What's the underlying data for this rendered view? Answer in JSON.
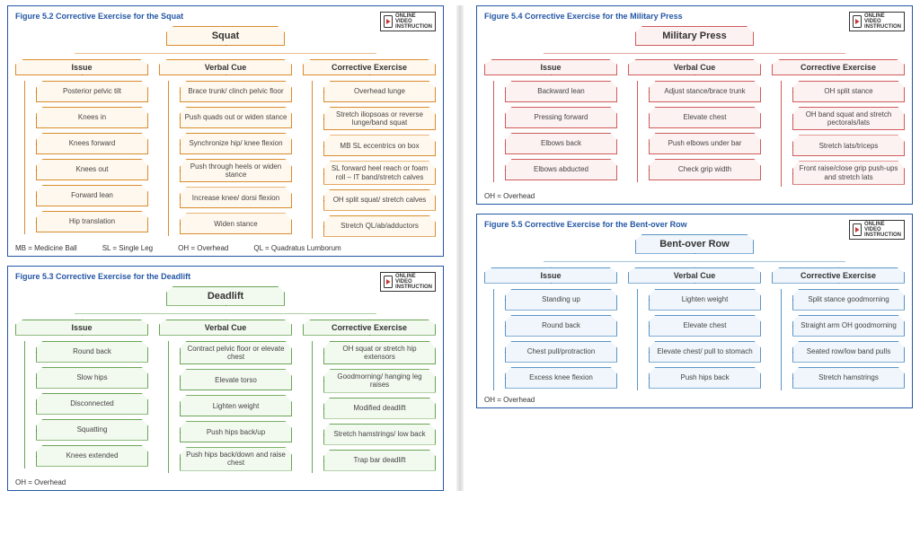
{
  "video_badge": {
    "line1": "ONLINE",
    "line2": "VIDEO",
    "line3": "INSTRUCTION"
  },
  "panels": [
    {
      "id": "squat",
      "title": "Figure 5.2   Corrective Exercise for the Squat",
      "root": "Squat",
      "theme": "theme-orange",
      "columns": [
        {
          "head": "Issue",
          "items": [
            "Posterior pelvic tilt",
            "Knees in",
            "Knees forward",
            "Knees out",
            "Forward lean",
            "Hip translation"
          ]
        },
        {
          "head": "Verbal Cue",
          "items": [
            "Brace trunk/ clinch pelvic floor",
            "Push quads out or widen stance",
            "Synchronize hip/ knee flexion",
            "Push through heels or widen stance",
            "Increase knee/ dorsi flexion",
            "Widen stance"
          ]
        },
        {
          "head": "Corrective Exercise",
          "items": [
            "Overhead lunge",
            "Stretch iliopsoas or reverse lunge/band squat",
            "MB SL eccentrics on box",
            "SL forward heel reach or foam roll – IT band/stretch calves",
            "OH split squat/ stretch calves",
            "Stretch QL/ab/adductors"
          ]
        }
      ],
      "legend": [
        "MB  = Medicine Ball",
        "SL  = Single Leg",
        "OH  = Overhead",
        "QL  = Quadratus Lumborum"
      ]
    },
    {
      "id": "deadlift",
      "title": "Figure 5.3   Corrective Exercise for the Deadlift",
      "root": "Deadlift",
      "theme": "theme-green",
      "columns": [
        {
          "head": "Issue",
          "items": [
            "Round back",
            "Slow hips",
            "Disconnected",
            "Squatting",
            "Knees extended"
          ]
        },
        {
          "head": "Verbal Cue",
          "items": [
            "Contract pelvic floor or elevate chest",
            "Elevate torso",
            "Lighten weight",
            "Push hips back/up",
            "Push hips back/down and raise chest"
          ]
        },
        {
          "head": "Corrective Exercise",
          "items": [
            "OH squat or stretch hip extensors",
            "Goodmorning/ hanging leg raises",
            "Modified deadlift",
            "Stretch hamstrings/ low back",
            "Trap bar deadlift"
          ]
        }
      ],
      "legend": [
        "OH  = Overhead"
      ]
    },
    {
      "id": "military",
      "title": "Figure 5.4   Corrective Exercise for the Military Press",
      "root": "Military Press",
      "theme": "theme-red",
      "columns": [
        {
          "head": "Issue",
          "items": [
            "Backward lean",
            "Pressing forward",
            "Elbows back",
            "Elbows abducted"
          ]
        },
        {
          "head": "Verbal Cue",
          "items": [
            "Adjust stance/brace trunk",
            "Elevate chest",
            "Push elbows under bar",
            "Check grip width"
          ]
        },
        {
          "head": "Corrective Exercise",
          "items": [
            "OH split stance",
            "OH band squat and stretch pectorals/lats",
            "Stretch lats/triceps",
            "Front raise/close grip push-ups and stretch lats"
          ]
        }
      ],
      "legend": [
        "OH  = Overhead"
      ]
    },
    {
      "id": "row",
      "title": "Figure 5.5   Corrective Exercise for the Bent-over Row",
      "root": "Bent-over Row",
      "theme": "theme-blue",
      "columns": [
        {
          "head": "Issue",
          "items": [
            "Standing up",
            "Round back",
            "Chest pull/protraction",
            "Excess knee flexion"
          ]
        },
        {
          "head": "Verbal Cue",
          "items": [
            "Lighten weight",
            "Elevate chest",
            "Elevate chest/ pull to stomach",
            "Push hips back"
          ]
        },
        {
          "head": "Corrective Exercise",
          "items": [
            "Split stance goodmorning",
            "Straight arm OH goodmorning",
            "Seated row/low band pulls",
            "Stretch hamstrings"
          ]
        }
      ],
      "legend": [
        "OH  = Overhead"
      ]
    }
  ]
}
